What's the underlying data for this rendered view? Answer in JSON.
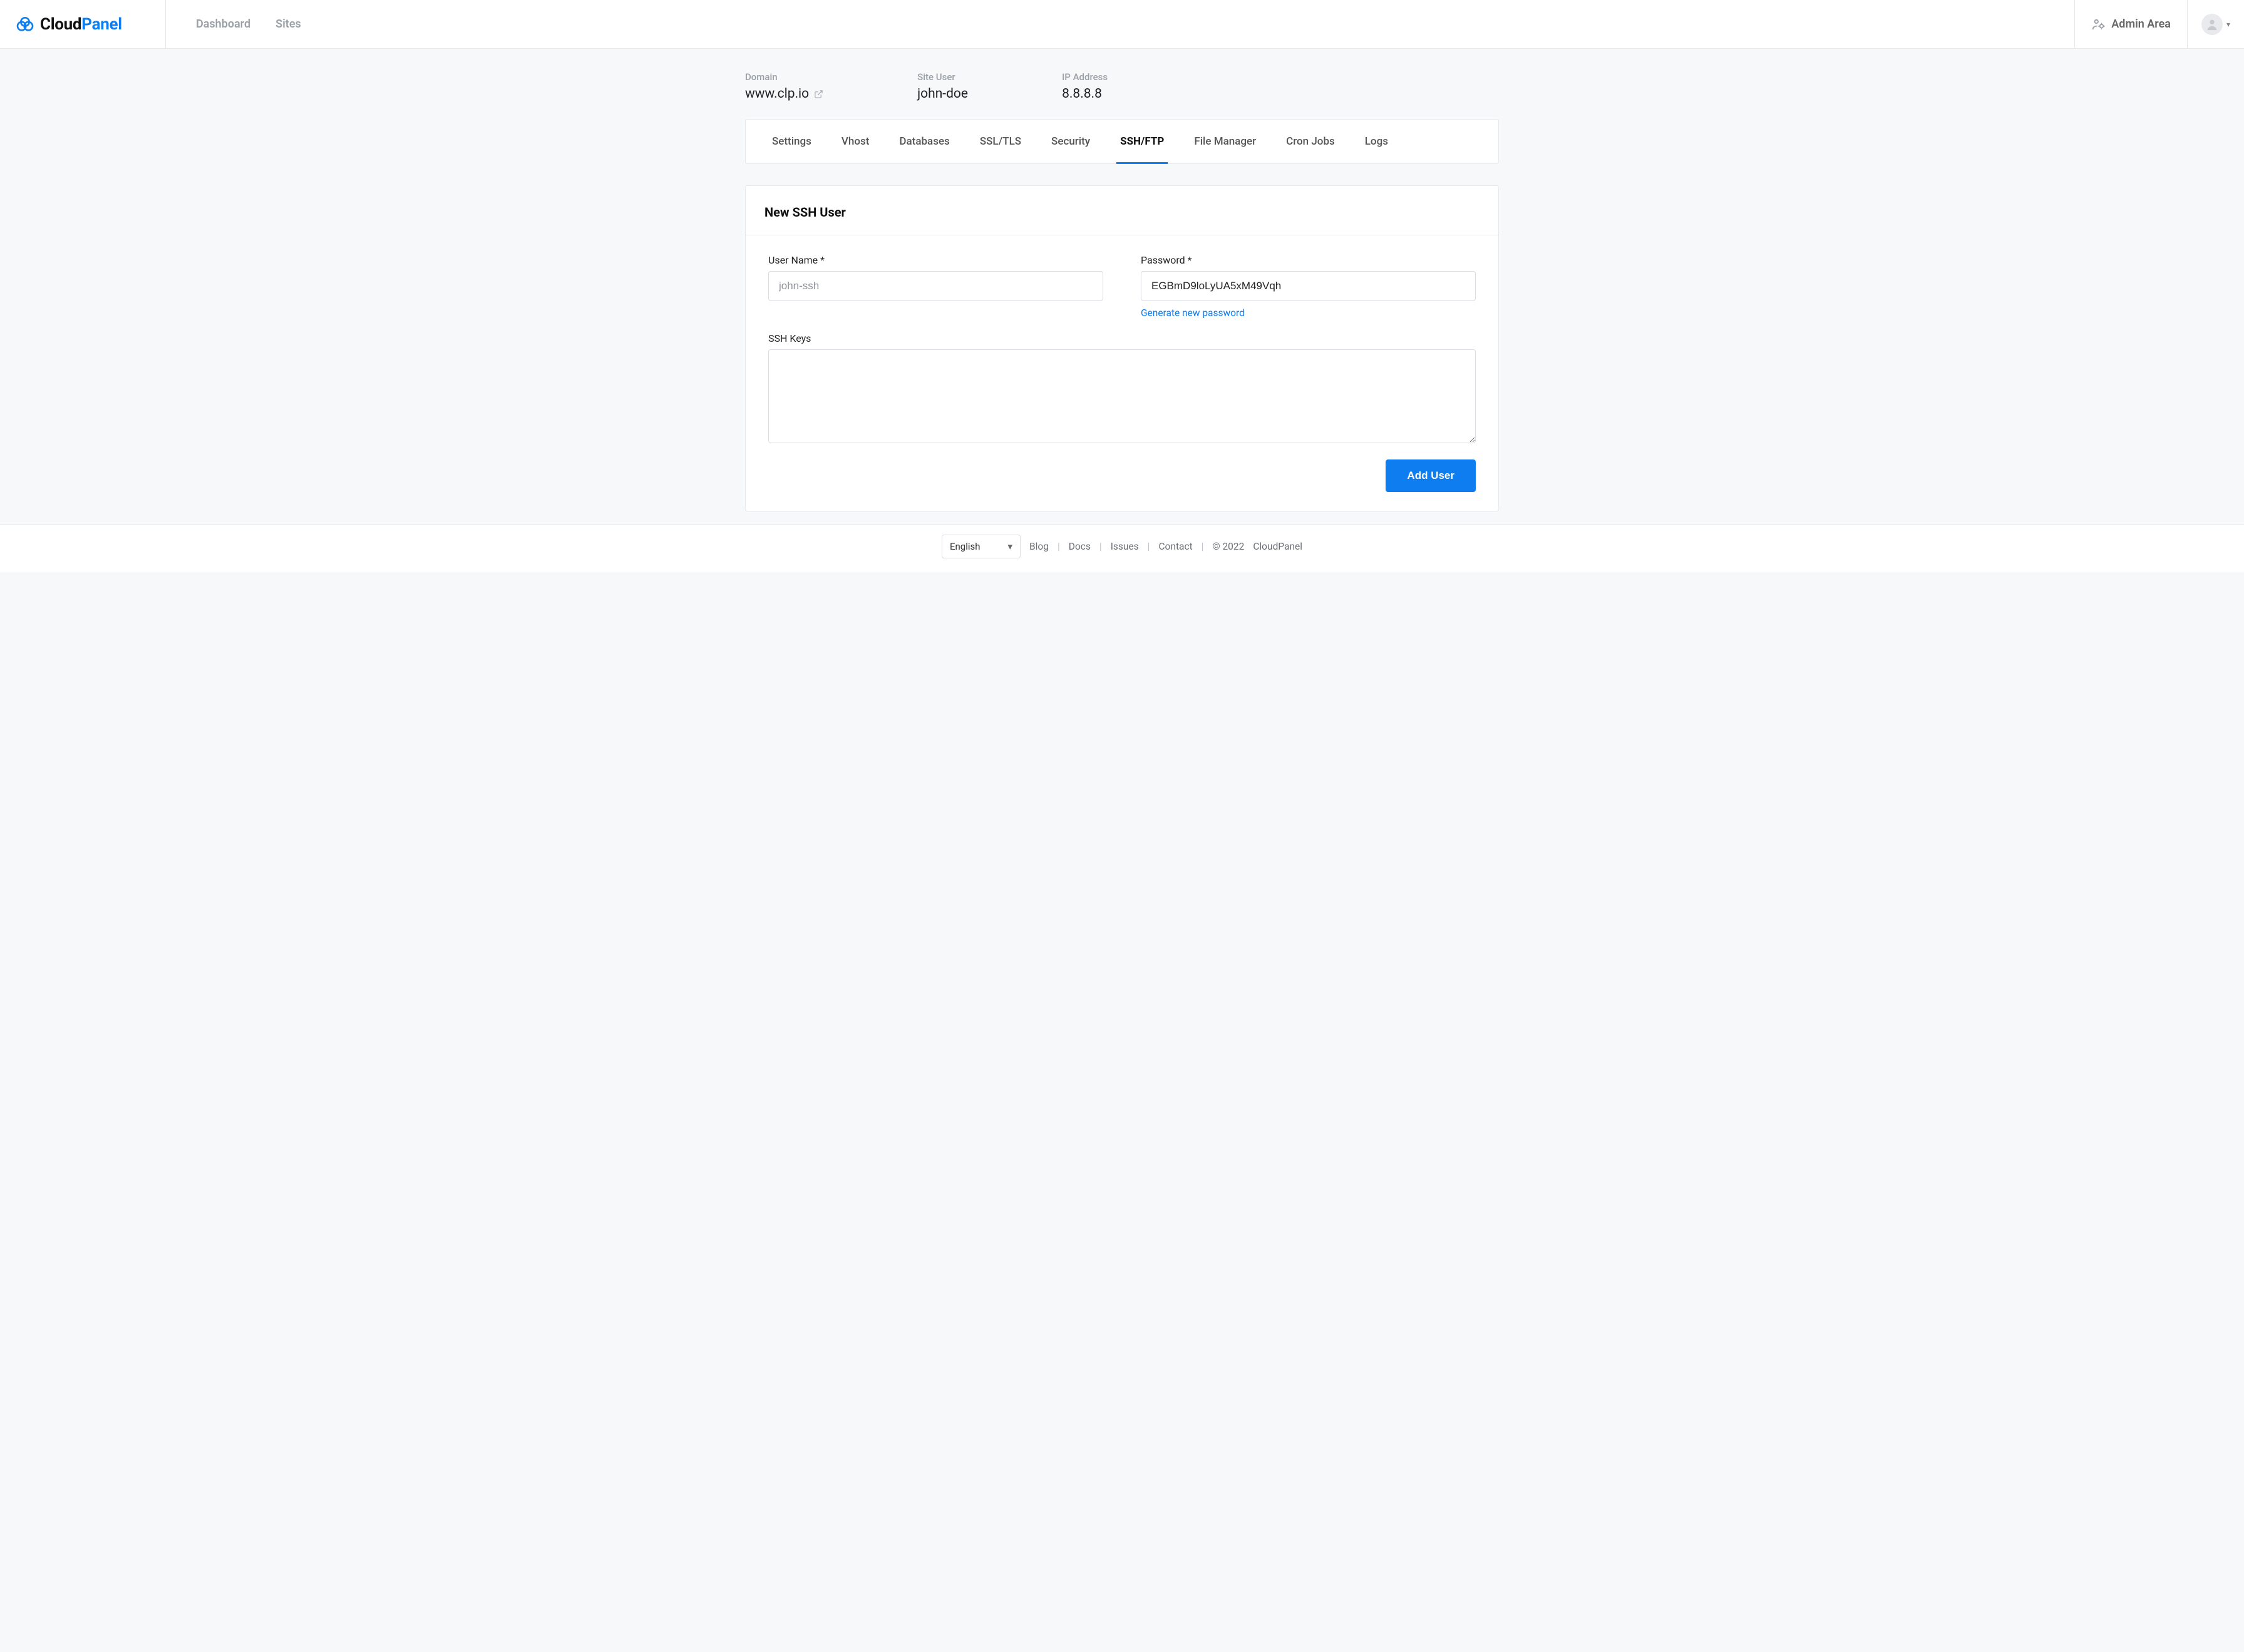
{
  "brand": {
    "part1": "Cloud",
    "part2": "Panel"
  },
  "topnav": {
    "dashboard": "Dashboard",
    "sites": "Sites"
  },
  "admin_area_label": "Admin Area",
  "site_info": {
    "domain_label": "Domain",
    "domain_value": "www.clp.io",
    "user_label": "Site User",
    "user_value": "john-doe",
    "ip_label": "IP Address",
    "ip_value": "8.8.8.8"
  },
  "tabs": {
    "settings": "Settings",
    "vhost": "Vhost",
    "databases": "Databases",
    "ssl": "SSL/TLS",
    "security": "Security",
    "sshftp": "SSH/FTP",
    "file_manager": "File Manager",
    "cron": "Cron Jobs",
    "logs": "Logs"
  },
  "form": {
    "title": "New SSH User",
    "username_label": "User Name *",
    "username_placeholder": "john-ssh",
    "password_label": "Password *",
    "password_value": "EGBmD9loLyUA5xM49Vqh",
    "generate_link": "Generate new password",
    "sshkeys_label": "SSH Keys",
    "submit_label": "Add User"
  },
  "footer": {
    "language": "English",
    "blog": "Blog",
    "docs": "Docs",
    "issues": "Issues",
    "contact": "Contact",
    "copyright": "© 2022",
    "brand": "CloudPanel"
  }
}
